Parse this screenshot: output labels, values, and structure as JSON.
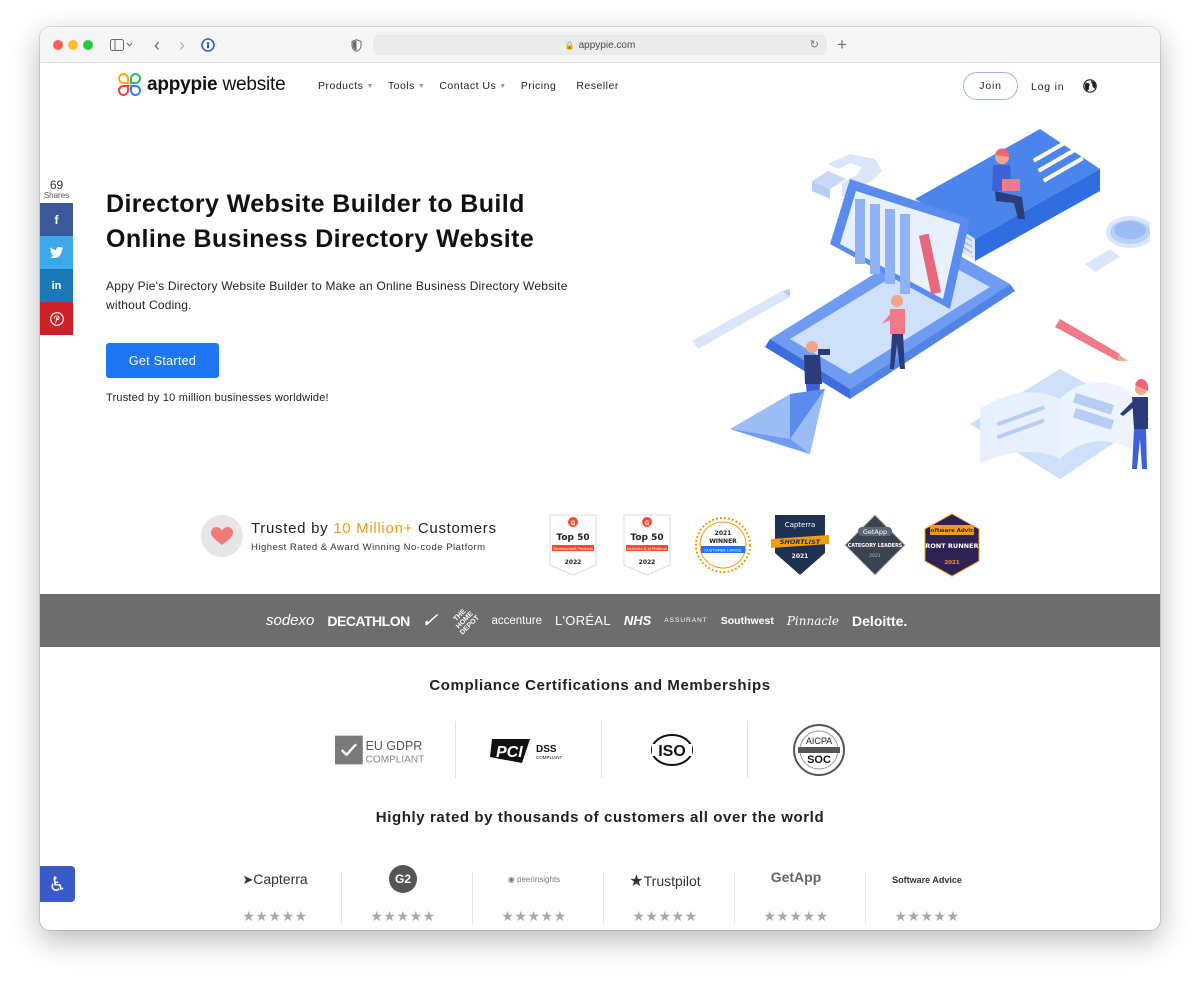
{
  "browser": {
    "url": "appypie.com",
    "lock_glyph": "🔒",
    "reload_glyph": "↻",
    "new_tab_glyph": "+",
    "back_glyph": "‹",
    "forward_glyph": "›"
  },
  "nav": {
    "logo_light": "appypie",
    "logo_bold": " website",
    "links": [
      {
        "label": "Products",
        "has_caret": true
      },
      {
        "label": "Tools",
        "has_caret": true
      },
      {
        "label": "Contact Us",
        "has_caret": true
      },
      {
        "label": "Pricing",
        "has_caret": false
      },
      {
        "label": "Reseller",
        "has_caret": false
      }
    ],
    "join_label": "Join",
    "login_label": "Log in"
  },
  "share": {
    "count": "69",
    "label": "Shares",
    "buttons": [
      {
        "name": "facebook",
        "glyph": "f",
        "color": "#3b5998"
      },
      {
        "name": "twitter",
        "glyph": "t",
        "color": "#3ea9ea"
      },
      {
        "name": "linkedin",
        "glyph": "in",
        "color": "#1b77b5"
      },
      {
        "name": "pinterest",
        "glyph": "P",
        "color": "#cb2127"
      }
    ]
  },
  "hero": {
    "title": "Directory Website Builder to Build Online Business Directory Website",
    "subtitle": "Appy Pie's Directory Website Builder to Make an Online Business Directory Website without Coding.",
    "cta_label": "Get Started",
    "trust_line": "Trusted by 10 million businesses worldwide!"
  },
  "trusted": {
    "title_pre": "Trusted by ",
    "title_accent": "10 Million+",
    "title_post": " Customers",
    "subtitle": "Highest Rated & Award Winning No-code Platform",
    "accent_color": "#f39c12",
    "badges": [
      {
        "top": "Top 50",
        "mid": "Development Products",
        "bottom": "2022"
      },
      {
        "top": "Top 50",
        "mid": "Analytics & AI Products",
        "bottom": "2022"
      },
      {
        "top": "2021",
        "mid": "WINNER",
        "bottom": "CUSTOMER CHOICE"
      },
      {
        "top": "Capterra",
        "mid": "SHORTLIST",
        "bottom": "2021"
      },
      {
        "top": "GetApp",
        "mid": "CATEGORY LEADERS",
        "bottom": "2021"
      },
      {
        "top": "Software Advice",
        "mid": "FRONT RUNNERS",
        "bottom": "2021"
      }
    ]
  },
  "brands": [
    "sodexo",
    "DECATHLON",
    "✓",
    "THE HOME DEPOT",
    "accenture",
    "L'ORÉAL",
    "NHS",
    "ASSURANT",
    "Southwest",
    "Pinnacle",
    "Deloitte."
  ],
  "compliance": {
    "title": "Compliance Certifications and Memberships",
    "items": [
      {
        "line1": "EU GDPR",
        "line2": "COMPLIANT"
      },
      {
        "line1": "DSS",
        "line2": "COMPLIANT"
      },
      {
        "line1": "ISO",
        "line2": ""
      },
      {
        "line1": "AICPA",
        "line2": "SOC"
      }
    ]
  },
  "rated": {
    "title": "Highly rated by thousands of customers all over the world",
    "platforms": [
      {
        "name": "Capterra",
        "stars": "★★★★★"
      },
      {
        "name": "G2",
        "stars": "★★★★★"
      },
      {
        "name": "peerinsights",
        "stars": "★★★★★"
      },
      {
        "name": "Trustpilot",
        "stars": "★★★★★"
      },
      {
        "name": "GetApp",
        "stars": "★★★★★"
      },
      {
        "name": "Software Advice",
        "stars": "★★★★★"
      }
    ]
  },
  "accessibility_glyph": "♿"
}
